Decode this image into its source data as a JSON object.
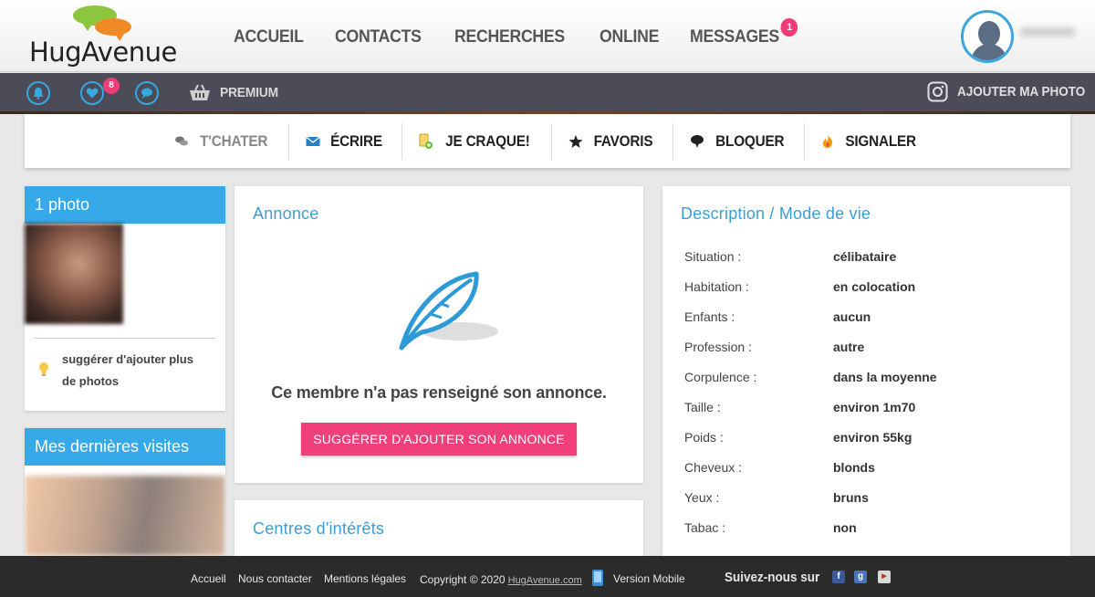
{
  "brand": {
    "logo_text": "HugAvenue"
  },
  "nav": {
    "items": [
      {
        "label": "ACCUEIL"
      },
      {
        "label": "CONTACTS"
      },
      {
        "label": "RECHERCHES"
      },
      {
        "label": "ONLINE"
      },
      {
        "label": "MESSAGES"
      }
    ],
    "messages_badge": "1"
  },
  "subnav": {
    "favorites_badge": "8",
    "premium_label": "PREMIUM",
    "add_photo_label": "AJOUTER MA PHOTO"
  },
  "actions": [
    {
      "label": "T'CHATER",
      "icon": "chat-icon"
    },
    {
      "label": "ÉCRIRE",
      "icon": "envelope-icon"
    },
    {
      "label": "JE CRAQUE!",
      "icon": "crush-icon"
    },
    {
      "label": "FAVORIS",
      "icon": "star-icon"
    },
    {
      "label": "BLOQUER",
      "icon": "block-icon"
    },
    {
      "label": "SIGNALER",
      "icon": "fire-icon"
    }
  ],
  "photos": {
    "title": "1 photo",
    "suggest_text": "suggérer d'ajouter plus de photos"
  },
  "visits": {
    "title": "Mes dernières visites"
  },
  "annonce": {
    "title": "Annonce",
    "empty_message": "Ce membre n'a pas renseigné son annonce.",
    "button_label": "SUGGÉRER D'AJOUTER SON ANNONCE"
  },
  "interests": {
    "title": "Centres d'intérêts"
  },
  "description": {
    "title": "Description / Mode de vie",
    "rows": [
      {
        "key": "Situation :",
        "value": "célibataire"
      },
      {
        "key": "Habitation :",
        "value": "en colocation"
      },
      {
        "key": "Enfants :",
        "value": "aucun"
      },
      {
        "key": "Profession :",
        "value": "autre"
      },
      {
        "key": "Corpulence :",
        "value": "dans la moyenne"
      },
      {
        "key": "Taille :",
        "value": "environ 1m70"
      },
      {
        "key": "Poids :",
        "value": "environ 55kg"
      },
      {
        "key": "Cheveux :",
        "value": "blonds"
      },
      {
        "key": "Yeux :",
        "value": "bruns"
      },
      {
        "key": "Tabac :",
        "value": "non"
      }
    ]
  },
  "footer": {
    "home": "Accueil",
    "contact": "Nous contacter",
    "legal": "Mentions légales",
    "copyright_prefix": "Copyright © 2020",
    "copyright_link": "HugAvenue.com",
    "mobile": "Version Mobile",
    "follow": "Suivez-nous sur"
  },
  "colors": {
    "accent_blue": "#36a9e8",
    "accent_pink": "#f13f7b",
    "dark_bar": "#4b4c57",
    "footer_bg": "#2b2b2b"
  }
}
